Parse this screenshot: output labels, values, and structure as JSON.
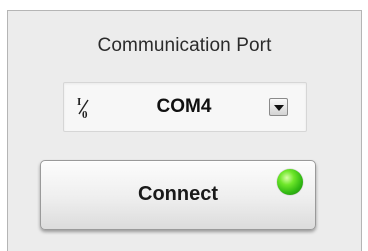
{
  "panel": {
    "title": "Communication Port"
  },
  "port_selector": {
    "icon": "io-resource-icon",
    "selected_value": "COM4",
    "dropdown_icon": "dropdown-arrow-icon"
  },
  "connect_button": {
    "label": "Connect",
    "indicator": {
      "icon": "status-led-icon",
      "state": "on",
      "color": "#3fcc14"
    }
  }
}
